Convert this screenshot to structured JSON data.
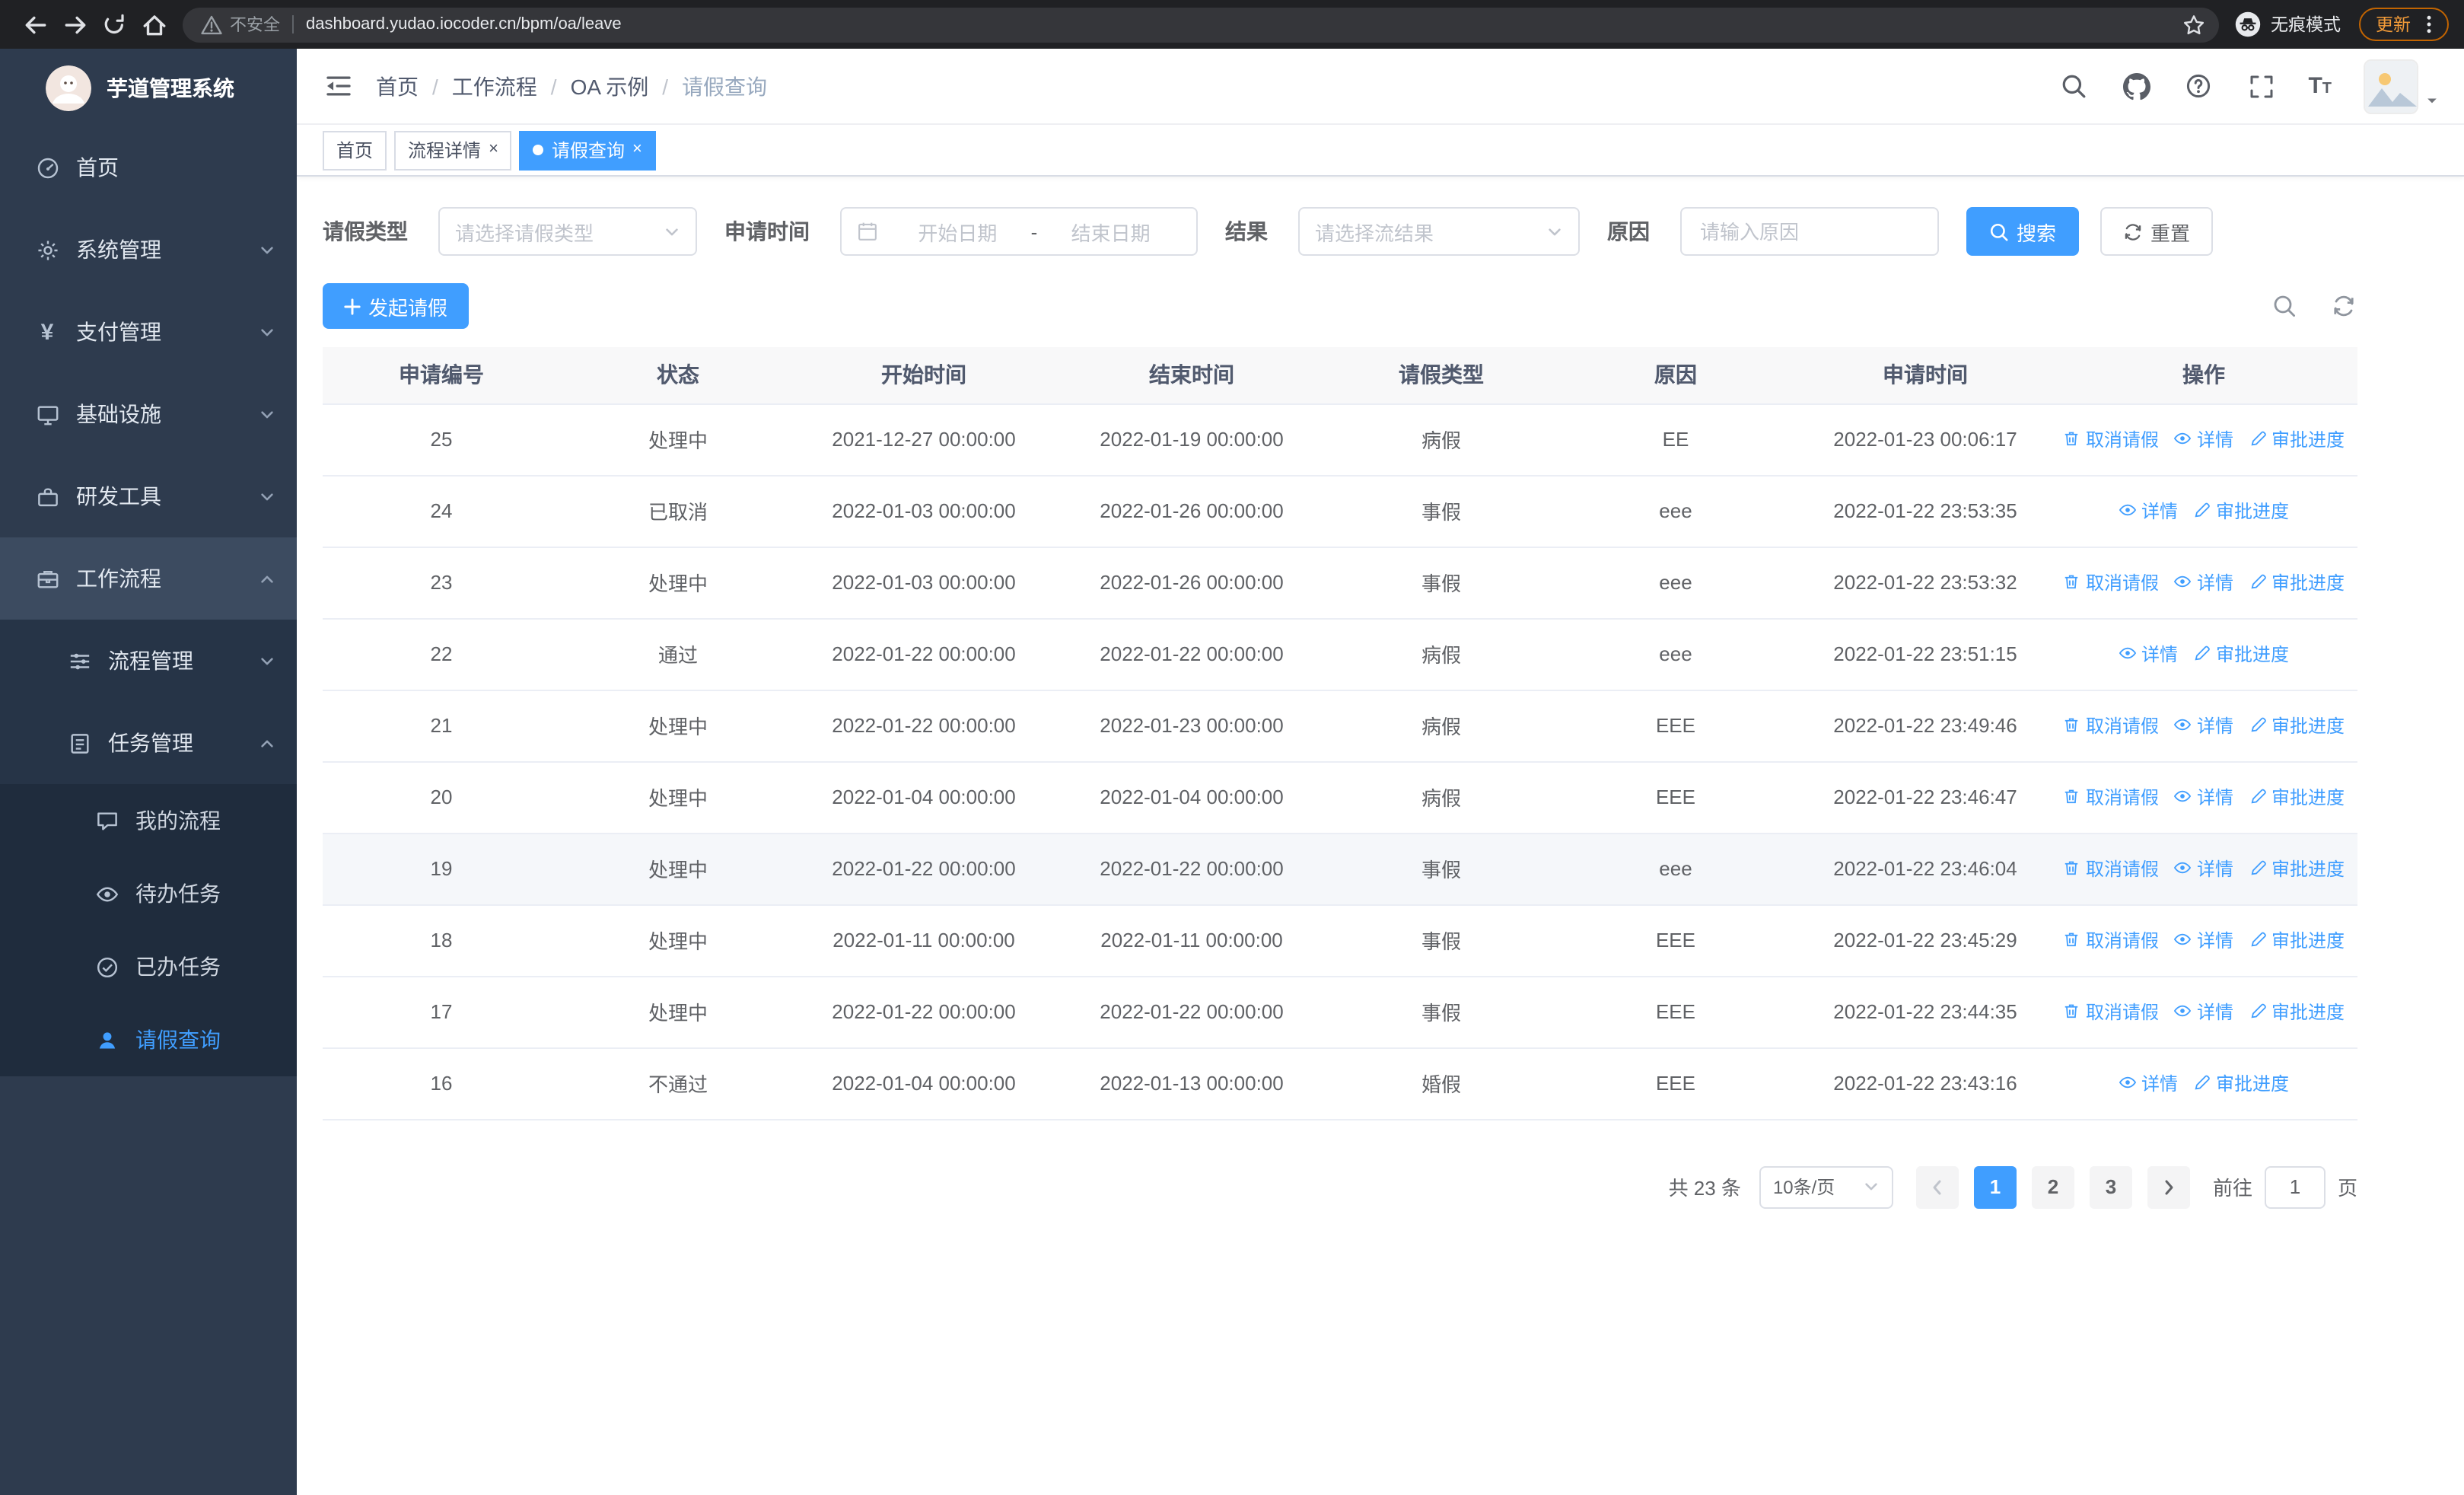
{
  "browser": {
    "security_label": "不安全",
    "url": "dashboard.yudao.iocoder.cn/bpm/oa/leave",
    "incognito_label": "无痕模式",
    "update_label": "更新"
  },
  "sidebar": {
    "logo_title": "芋道管理系统",
    "items": [
      {
        "label": "首页"
      },
      {
        "label": "系统管理"
      },
      {
        "label": "支付管理"
      },
      {
        "label": "基础设施"
      },
      {
        "label": "研发工具"
      },
      {
        "label": "工作流程"
      },
      {
        "label": "流程管理"
      },
      {
        "label": "任务管理"
      },
      {
        "label": "我的流程"
      },
      {
        "label": "待办任务"
      },
      {
        "label": "已办任务"
      },
      {
        "label": "请假查询"
      }
    ]
  },
  "header": {
    "breadcrumb": [
      "首页",
      "工作流程",
      "OA 示例",
      "请假查询"
    ]
  },
  "tabs": [
    {
      "label": "首页"
    },
    {
      "label": "流程详情"
    },
    {
      "label": "请假查询"
    }
  ],
  "filters": {
    "leave_type_label": "请假类型",
    "leave_type_placeholder": "请选择请假类型",
    "apply_time_label": "申请时间",
    "start_date_placeholder": "开始日期",
    "range_separator": "-",
    "end_date_placeholder": "结束日期",
    "result_label": "结果",
    "result_placeholder": "请选择流结果",
    "reason_label": "原因",
    "reason_placeholder": "请输入原因",
    "search_label": "搜索",
    "reset_label": "重置"
  },
  "toolbar": {
    "create_label": "发起请假"
  },
  "table": {
    "columns": [
      "申请编号",
      "状态",
      "开始时间",
      "结束时间",
      "请假类型",
      "原因",
      "申请时间",
      "操作"
    ],
    "action_defs": {
      "cancel": {
        "label": "取消请假",
        "icon": "delete-icon",
        "name": "cancel-leave-link"
      },
      "detail": {
        "label": "详情",
        "icon": "view-icon",
        "name": "detail-link"
      },
      "progress": {
        "label": "审批进度",
        "icon": "edit-icon",
        "name": "approval-progress-link"
      }
    },
    "rows": [
      {
        "id": "25",
        "status": "处理中",
        "start": "2021-12-27 00:00:00",
        "end": "2022-01-19 00:00:00",
        "type": "病假",
        "reason": "EE",
        "applied": "2022-01-23 00:06:17",
        "actions": [
          "cancel",
          "detail",
          "progress"
        ]
      },
      {
        "id": "24",
        "status": "已取消",
        "start": "2022-01-03 00:00:00",
        "end": "2022-01-26 00:00:00",
        "type": "事假",
        "reason": "eee",
        "applied": "2022-01-22 23:53:35",
        "actions": [
          "detail",
          "progress"
        ]
      },
      {
        "id": "23",
        "status": "处理中",
        "start": "2022-01-03 00:00:00",
        "end": "2022-01-26 00:00:00",
        "type": "事假",
        "reason": "eee",
        "applied": "2022-01-22 23:53:32",
        "actions": [
          "cancel",
          "detail",
          "progress"
        ]
      },
      {
        "id": "22",
        "status": "通过",
        "start": "2022-01-22 00:00:00",
        "end": "2022-01-22 00:00:00",
        "type": "病假",
        "reason": "eee",
        "applied": "2022-01-22 23:51:15",
        "actions": [
          "detail",
          "progress"
        ]
      },
      {
        "id": "21",
        "status": "处理中",
        "start": "2022-01-22 00:00:00",
        "end": "2022-01-23 00:00:00",
        "type": "病假",
        "reason": "EEE",
        "applied": "2022-01-22 23:49:46",
        "actions": [
          "cancel",
          "detail",
          "progress"
        ]
      },
      {
        "id": "20",
        "status": "处理中",
        "start": "2022-01-04 00:00:00",
        "end": "2022-01-04 00:00:00",
        "type": "病假",
        "reason": "EEE",
        "applied": "2022-01-22 23:46:47",
        "actions": [
          "cancel",
          "detail",
          "progress"
        ]
      },
      {
        "id": "19",
        "status": "处理中",
        "start": "2022-01-22 00:00:00",
        "end": "2022-01-22 00:00:00",
        "type": "事假",
        "reason": "eee",
        "applied": "2022-01-22 23:46:04",
        "actions": [
          "cancel",
          "detail",
          "progress"
        ],
        "highlighted": true
      },
      {
        "id": "18",
        "status": "处理中",
        "start": "2022-01-11 00:00:00",
        "end": "2022-01-11 00:00:00",
        "type": "事假",
        "reason": "EEE",
        "applied": "2022-01-22 23:45:29",
        "actions": [
          "cancel",
          "detail",
          "progress"
        ]
      },
      {
        "id": "17",
        "status": "处理中",
        "start": "2022-01-22 00:00:00",
        "end": "2022-01-22 00:00:00",
        "type": "事假",
        "reason": "EEE",
        "applied": "2022-01-22 23:44:35",
        "actions": [
          "cancel",
          "detail",
          "progress"
        ]
      },
      {
        "id": "16",
        "status": "不通过",
        "start": "2022-01-04 00:00:00",
        "end": "2022-01-13 00:00:00",
        "type": "婚假",
        "reason": "EEE",
        "applied": "2022-01-22 23:43:16",
        "actions": [
          "detail",
          "progress"
        ]
      }
    ]
  },
  "pagination": {
    "total_label": "共 23 条",
    "page_size_label": "10条/页",
    "pages": [
      "1",
      "2",
      "3"
    ],
    "active_page": "1",
    "goto_label": "前往",
    "goto_value": "1",
    "page_unit_label": "页"
  }
}
